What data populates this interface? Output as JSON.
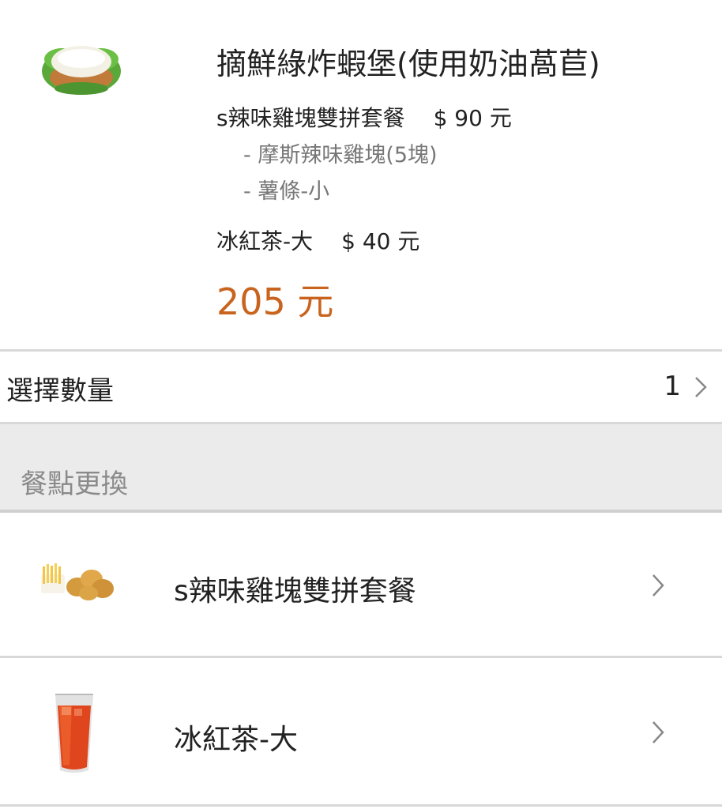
{
  "product": {
    "title": "摘鮮綠炸蝦堡(使用奶油萵苣)",
    "set": {
      "name": "s辣味雞塊雙拼套餐",
      "price": "$ 90 元",
      "items": [
        "- 摩斯辣味雞塊(5塊)",
        "- 薯條-小"
      ]
    },
    "drink": {
      "name": "冰紅茶-大",
      "price": "$ 40 元"
    },
    "total": "205 元",
    "image_icon": "burger-image"
  },
  "quantity": {
    "label": "選擇數量",
    "value": "1"
  },
  "section": {
    "title": "餐點更換"
  },
  "swaps": [
    {
      "label": "s辣味雞塊雙拼套餐",
      "icon": "nuggets-fries-image"
    },
    {
      "label": "冰紅茶-大",
      "icon": "iced-tea-image"
    }
  ],
  "colors": {
    "accent": "#c8641e",
    "band": "#ebebeb",
    "divider": "#d8d8d8"
  }
}
